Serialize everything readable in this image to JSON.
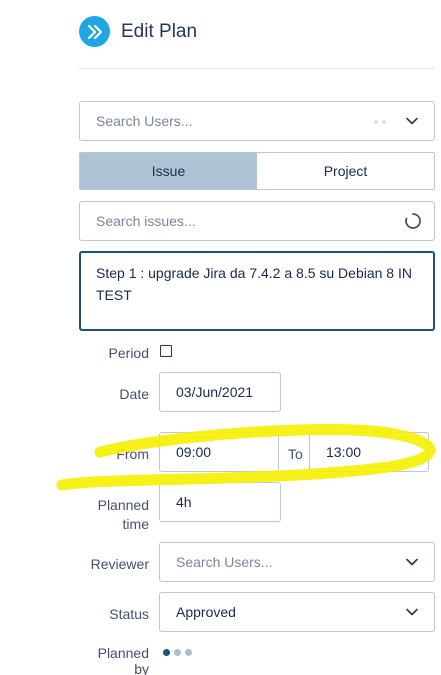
{
  "header": {
    "title": "Edit Plan",
    "icon": "double-chevron-right-icon"
  },
  "user_search": {
    "placeholder": "Search Users..."
  },
  "toggle": {
    "issue_label": "Issue",
    "project_label": "Project",
    "active": "Issue"
  },
  "issue_search": {
    "placeholder": "Search issues..."
  },
  "description": {
    "text": "Step 1 : upgrade Jira da 7.4.2 a 8.5 su Debian 8 IN TEST"
  },
  "form": {
    "period_label": "Period",
    "period_checked": false,
    "date_label": "Date",
    "date_value": "03/Jun/2021",
    "from_label": "From",
    "from_value": "09:00",
    "to_label": "To",
    "to_value": "13:00",
    "planned_time_label": "Planned time",
    "planned_time_value": "4h",
    "reviewer_label": "Reviewer",
    "reviewer_placeholder": "Search Users...",
    "status_label": "Status",
    "status_value": "Approved",
    "planned_by_label": "Planned by"
  },
  "colors": {
    "accent": "#1ea7e4",
    "toggle_active": "#aec4d6",
    "focus_border": "#1b4f7c",
    "highlight": "#f5f000"
  }
}
